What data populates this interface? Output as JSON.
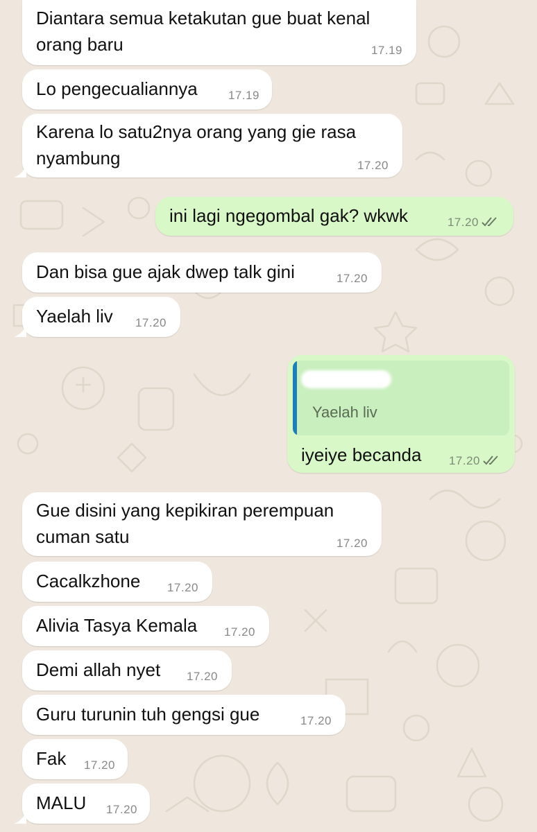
{
  "messages": [
    {
      "dir": "in",
      "lines": [
        "Diantara semua ketakutan gue buat kenal",
        "orang baru"
      ],
      "time": "17.19"
    },
    {
      "dir": "in",
      "lines": [
        "Lo pengecualiannya"
      ],
      "time": "17.19"
    },
    {
      "dir": "in",
      "lines": [
        "Karena lo satu2nya orang yang gie rasa",
        "nyambung"
      ],
      "time": "17.20"
    },
    {
      "dir": "out",
      "lines": [
        "ini lagi ngegombal gak? wkwk"
      ],
      "time": "17.20",
      "status": "read"
    },
    {
      "dir": "in",
      "lines": [
        "Dan bisa gue ajak dwep talk gini"
      ],
      "time": "17.20"
    },
    {
      "dir": "in",
      "lines": [
        "Yaelah liv"
      ],
      "time": "17.20"
    },
    {
      "dir": "out",
      "quote": {
        "text": "Yaelah liv"
      },
      "lines": [
        "iyeiye becanda"
      ],
      "time": "17.20",
      "status": "read"
    },
    {
      "dir": "in",
      "lines": [
        "Gue disini yang kepikiran perempuan",
        "cuman satu"
      ],
      "time": "17.20"
    },
    {
      "dir": "in",
      "lines": [
        "Cacalkzhone"
      ],
      "time": "17.20"
    },
    {
      "dir": "in",
      "lines": [
        "Alivia Tasya Kemala"
      ],
      "time": "17.20"
    },
    {
      "dir": "in",
      "lines": [
        "Demi allah nyet"
      ],
      "time": "17.20"
    },
    {
      "dir": "in",
      "lines": [
        "Guru turunin tuh gengsi gue"
      ],
      "time": "17.20"
    },
    {
      "dir": "in",
      "lines": [
        "Fak"
      ],
      "time": "17.20"
    },
    {
      "dir": "in",
      "lines": [
        "MALU"
      ],
      "time": "17.20"
    }
  ],
  "colors": {
    "background": "#efe7dd",
    "incoming": "#ffffff",
    "outgoing": "#d8f8c8",
    "time": "#888888",
    "quote_bar": "#1c7fb8"
  },
  "icons": {
    "read_status": "double-check-icon"
  }
}
